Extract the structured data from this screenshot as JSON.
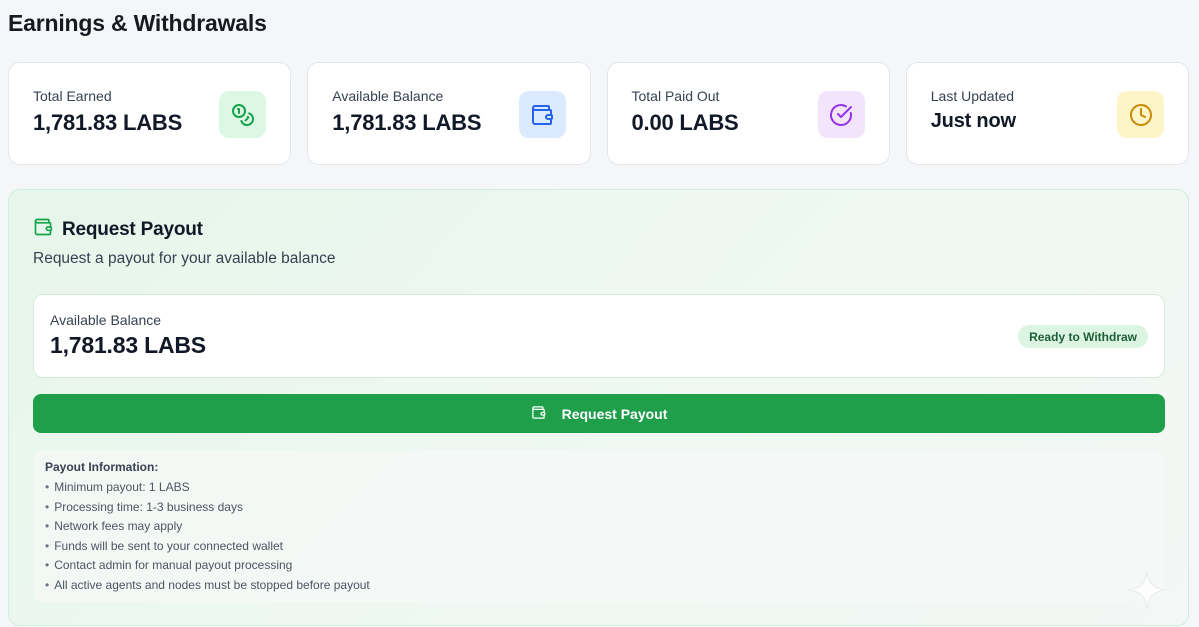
{
  "page": {
    "title": "Earnings & Withdrawals"
  },
  "stats": [
    {
      "label": "Total Earned",
      "value": "1,781.83 LABS",
      "icon": "coins-icon",
      "icon_bg": "#dcf7e4",
      "icon_color": "#16a34a"
    },
    {
      "label": "Available Balance",
      "value": "1,781.83 LABS",
      "icon": "wallet-icon",
      "icon_bg": "#dbeafe",
      "icon_color": "#2563eb"
    },
    {
      "label": "Total Paid Out",
      "value": "0.00 LABS",
      "icon": "check-circle-icon",
      "icon_bg": "#f1e4fb",
      "icon_color": "#9333ea"
    },
    {
      "label": "Last Updated",
      "value": "Just now",
      "icon": "clock-icon",
      "icon_bg": "#fdf4c7",
      "icon_color": "#ca8a04"
    }
  ],
  "payout": {
    "title": "Request Payout",
    "subtitle": "Request a payout for your available balance",
    "balance_label": "Available Balance",
    "balance_value": "1,781.83 LABS",
    "status_badge": "Ready to Withdraw",
    "button_label": "Request Payout",
    "accent_color": "#1f9f4a",
    "info": {
      "title": "Payout Information:",
      "items": [
        "Minimum payout: 1 LABS",
        "Processing time: 1-3 business days",
        "Network fees may apply",
        "Funds will be sent to your connected wallet",
        "Contact admin for manual payout processing",
        "All active agents and nodes must be stopped before payout"
      ]
    }
  }
}
